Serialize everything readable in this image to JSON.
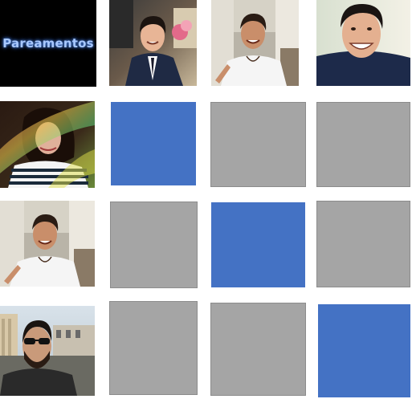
{
  "title": "Pareamentos",
  "colors": {
    "match": "#4472c4",
    "no_match": "#a5a5a5",
    "title_bg": "#000000",
    "title_text": "#a8c8ff"
  },
  "column_photos": [
    "man-suit-photo",
    "man-white-shirt-photo",
    "man-hoodie-smiling-photo"
  ],
  "row_photos": [
    "woman-striped-shirt-photo",
    "man-white-shirt-photo",
    "man-sunglasses-photo"
  ],
  "matrix": [
    [
      "match",
      "no-match",
      "no-match"
    ],
    [
      "no-match",
      "match",
      "no-match"
    ],
    [
      "no-match",
      "no-match",
      "match"
    ]
  ]
}
